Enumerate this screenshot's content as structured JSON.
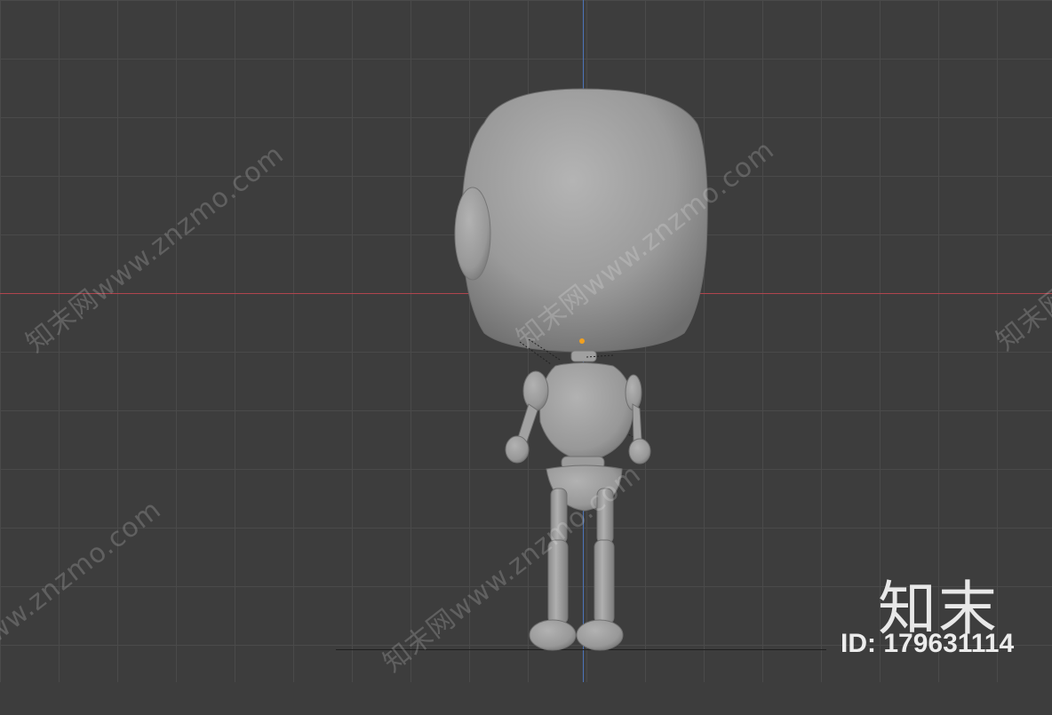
{
  "watermark": {
    "repeat_text": "知末网www.znzmo.com",
    "brand": "知末",
    "id_label": "ID: 179631114"
  },
  "colors": {
    "background": "#3d3d3d",
    "grid": "#4a4a4a",
    "x_axis": "#b0454e",
    "z_axis": "#4c74b8",
    "model": "#9a9a9a",
    "origin_point": "#f0a020"
  }
}
